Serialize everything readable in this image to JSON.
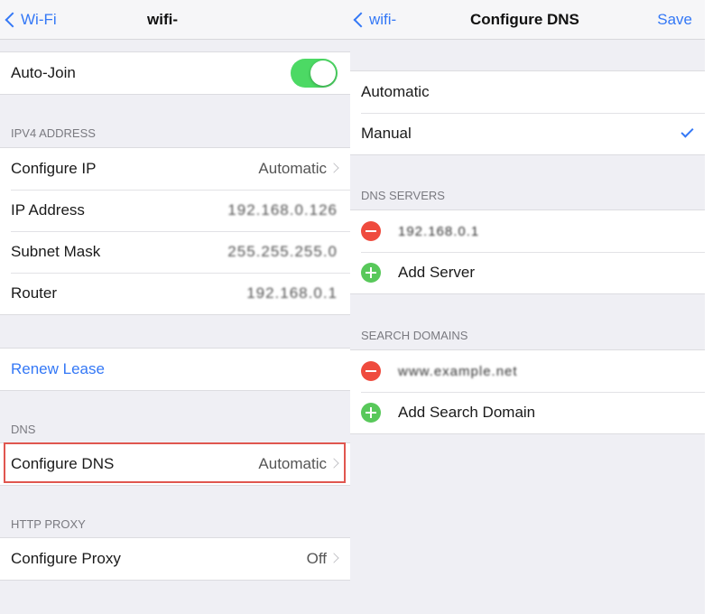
{
  "left": {
    "nav": {
      "back_label": "Wi-Fi",
      "title": "wifi-"
    },
    "auto_join": {
      "label": "Auto-Join",
      "on": true
    },
    "ipv4": {
      "header": "IPV4 ADDRESS",
      "configure_ip": {
        "label": "Configure IP",
        "value": "Automatic"
      },
      "ip_address": {
        "label": "IP Address",
        "value": "192.168.0.126"
      },
      "subnet_mask": {
        "label": "Subnet Mask",
        "value": "255.255.255.0"
      },
      "router": {
        "label": "Router",
        "value": "192.168.0.1"
      }
    },
    "renew_lease": "Renew Lease",
    "dns": {
      "header": "DNS",
      "configure_dns": {
        "label": "Configure DNS",
        "value": "Automatic"
      }
    },
    "http_proxy": {
      "header": "HTTP PROXY",
      "configure_proxy": {
        "label": "Configure Proxy",
        "value": "Off"
      }
    }
  },
  "right": {
    "nav": {
      "back_label": "wifi-",
      "title": "Configure DNS",
      "save_label": "Save"
    },
    "mode": {
      "automatic": "Automatic",
      "manual": "Manual",
      "selected": "Manual"
    },
    "dns_servers": {
      "header": "DNS SERVERS",
      "server": "192.168.0.1",
      "add_label": "Add Server"
    },
    "search_domains": {
      "header": "SEARCH DOMAINS",
      "domain": "www.example.net",
      "add_label": "Add Search Domain"
    }
  },
  "colors": {
    "accent": "#3478f6",
    "toggle_on": "#4cd964",
    "delete": "#ef4b3e",
    "add": "#58c85a",
    "highlight": "#e0564f"
  },
  "icons": [
    "chevron-left-icon",
    "chevron-right-icon",
    "checkmark-icon",
    "minus-circle-icon",
    "plus-circle-icon"
  ]
}
